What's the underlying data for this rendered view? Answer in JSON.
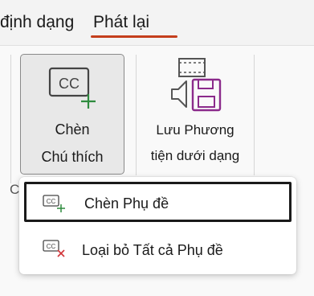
{
  "tabs": [
    {
      "label": "định dạng"
    },
    {
      "label": "Phát lại",
      "selected": true
    }
  ],
  "ribbon": {
    "insert_captions": {
      "line1": "Chèn",
      "line2": "Chú thích",
      "icon": "closed-captions-add-icon"
    },
    "save_media": {
      "line1": "Lưu Phương",
      "line2": "tiện dưới dạng",
      "icon": "save-media-icon"
    },
    "group_label_fragment": "C"
  },
  "menu": {
    "items": [
      {
        "label": "Chèn Phụ đề",
        "icon": "closed-captions-add-icon",
        "focused": true
      },
      {
        "label": "Loại bỏ Tất cả Phụ đề",
        "icon": "closed-captions-remove-icon"
      }
    ]
  },
  "colors": {
    "accent_underline": "#c43e1c",
    "add_green": "#2e8b3e",
    "remove_red": "#d13438",
    "media_purple": "#8b2a8b"
  }
}
